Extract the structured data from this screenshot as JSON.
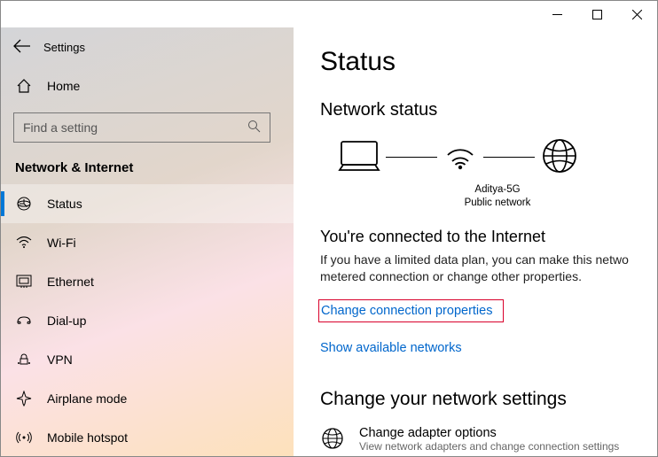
{
  "titlebar": {
    "app": "Settings"
  },
  "sidebar": {
    "back_label": "Settings",
    "home": "Home",
    "search_placeholder": "Find a setting",
    "section": "Network & Internet",
    "items": [
      {
        "label": "Status"
      },
      {
        "label": "Wi-Fi"
      },
      {
        "label": "Ethernet"
      },
      {
        "label": "Dial-up"
      },
      {
        "label": "VPN"
      },
      {
        "label": "Airplane mode"
      },
      {
        "label": "Mobile hotspot"
      }
    ]
  },
  "content": {
    "title": "Status",
    "subtitle": "Network status",
    "conn_name": "Aditya-5G",
    "conn_type": "Public network",
    "connected_heading": "You're connected to the Internet",
    "connected_body": "If you have a limited data plan, you can make this netwo metered connection or change other properties.",
    "link_change": "Change connection properties",
    "link_show": "Show available networks",
    "settings_heading": "Change your network settings",
    "adapter_title": "Change adapter options",
    "adapter_sub": "View network adapters and change connection settings"
  }
}
